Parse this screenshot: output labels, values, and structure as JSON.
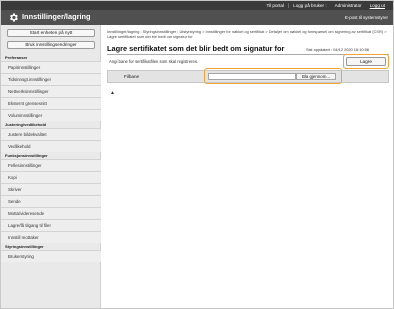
{
  "header": {
    "links": [
      "Til portal",
      "Logg på bruker :",
      "Administrator",
      "Logg ut"
    ],
    "app_title": "Innstillinger/lagring",
    "mail_link": "E-post til systemstyrer"
  },
  "sidebar": {
    "start_button": "Start enheten på nytt",
    "use_settings_button": "Bruk innstillingsendringer",
    "sections": [
      {
        "heading": "Preferanser",
        "items": [
          "Papirinnstillinger",
          "Tidsinnsgt.innstillinger",
          "Nettverksinnstillinger",
          "Eksternt grensesnitt",
          "Voluminnstillinger"
        ]
      },
      {
        "heading": "Justering/vedlikehold",
        "items": [
          "Justere bildekvalitet",
          "Vedlikehold"
        ]
      },
      {
        "heading": "Funksjonsinnstillinger",
        "items": [
          "Fellesinnstillinger",
          "Kopi",
          "Skriver",
          "Sende",
          "Motta/videresende",
          "Lagre/få tilgang til filer"
        ]
      },
      {
        "heading": "",
        "items": [
          "Innstill mottaker"
        ]
      },
      {
        "heading": "Styringsinnstillinger",
        "items": [
          "Brukerstyring"
        ]
      }
    ]
  },
  "main": {
    "breadcrumb": "Innstillinger/lagring : Styringsinnstillinger : Utstyrstyring > Innstillinger for nøkkel og sertifikat > Detaljer om nøkkel og forespørsel om signering av sertifikat (CSR) > Lagre sertifikatet som det blir bedt om signatur for",
    "title": "Lagre sertifikatet som det blir bedt om signatur for",
    "last_updated": "Sist oppdatert : 04/12 2020 16:10:58",
    "instruction": "Angi bane for sertifikatfilen som skal registreres.",
    "save_label": "Lagre",
    "file_path_label": "Filbane",
    "file_path_value": "",
    "browse_label": "Bla gjennom...",
    "top_link": "▲"
  }
}
